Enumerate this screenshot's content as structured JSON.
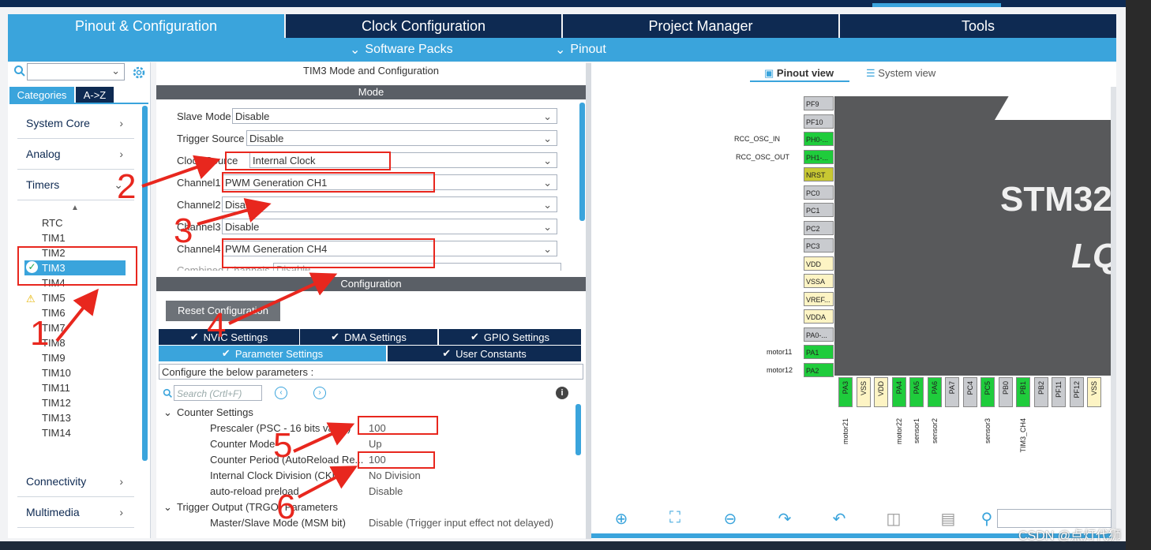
{
  "tabs": {
    "pinout_config": "Pinout & Configuration",
    "clock_config": "Clock Configuration",
    "project_manager": "Project Manager",
    "tools": "Tools"
  },
  "subbar": {
    "software_packs": "Software Packs",
    "pinout": "Pinout"
  },
  "sidebar": {
    "cat_tab": "Categories",
    "az_tab": "A->Z",
    "categories": [
      "System Core",
      "Analog",
      "Timers",
      "Connectivity",
      "Multimedia"
    ],
    "timers": [
      "RTC",
      "TIM1",
      "TIM2",
      "TIM3",
      "TIM4",
      "TIM5",
      "TIM6",
      "TIM7",
      "TIM8",
      "TIM9",
      "TIM10",
      "TIM11",
      "TIM12",
      "TIM13",
      "TIM14"
    ],
    "selected_timer": "TIM3"
  },
  "mode": {
    "title": "TIM3 Mode and Configuration",
    "header": "Mode",
    "rows": [
      {
        "label": "Slave Mode",
        "value": "Disable"
      },
      {
        "label": "Trigger Source",
        "value": "Disable"
      },
      {
        "label": "Clock Source",
        "value": "Internal Clock"
      },
      {
        "label": "Channel1",
        "value": "PWM Generation CH1"
      },
      {
        "label": "Channel2",
        "value": "Disable"
      },
      {
        "label": "Channel3",
        "value": "Disable"
      },
      {
        "label": "Channel4",
        "value": "PWM Generation CH4"
      },
      {
        "label": "Combined Channels",
        "value": "Disable"
      }
    ]
  },
  "config": {
    "header": "Configuration",
    "reset_button": "Reset Configuration",
    "tabs": [
      "NVIC Settings",
      "DMA Settings",
      "GPIO Settings",
      "Parameter Settings",
      "User Constants"
    ],
    "hint": "Configure the below parameters :",
    "search_placeholder": "Search (Crtl+F)",
    "counter_settings": "Counter Settings",
    "params": [
      {
        "label": "Prescaler (PSC - 16 bits value)",
        "value": "100"
      },
      {
        "label": "Counter Mode",
        "value": "Up"
      },
      {
        "label": "Counter Period (AutoReload Re...",
        "value": "100"
      },
      {
        "label": "Internal Clock Division (CKD)",
        "value": "No Division"
      },
      {
        "label": "auto-reload preload",
        "value": "Disable"
      }
    ],
    "trigger_output": "Trigger Output (TRGO) Parameters",
    "msm": {
      "label": "Master/Slave Mode (MSM bit)",
      "value": "Disable (Trigger input effect not delayed)"
    }
  },
  "pinout": {
    "pinout_view": "Pinout view",
    "system_view": "System view",
    "chip_text_1": "STM32",
    "chip_text_2": "LQ",
    "left_pins": [
      "PF9",
      "PF10",
      "PH0-...",
      "PH1-...",
      "NRST",
      "PC0",
      "PC1",
      "PC2",
      "PC3",
      "VDD",
      "VSSA",
      "VREF...",
      "VDDA",
      "PA0-...",
      "PA1",
      "PA2"
    ],
    "left_signals": {
      "rcc_in": "RCC_OSC_IN",
      "rcc_out": "RCC_OSC_OUT",
      "motor11": "motor11",
      "motor12": "motor12"
    },
    "bottom_pins": [
      "PA3",
      "VSS",
      "VDD",
      "PA4",
      "PA5",
      "PA6",
      "PA7",
      "PC4",
      "PC5",
      "PB0",
      "PB1",
      "PB2",
      "PF11",
      "PF12",
      "VSS"
    ],
    "bottom_signals": {
      "motor21": "motor21",
      "motor22": "motor22",
      "sensor1": "sensor1",
      "sensor2": "sensor2",
      "sensor3": "sensor3",
      "tim3ch4": "TIM3_CH4"
    }
  },
  "annotations": [
    "1",
    "2",
    "3",
    "4",
    "5",
    "6"
  ],
  "watermark": "CSDN @点灯代狮"
}
